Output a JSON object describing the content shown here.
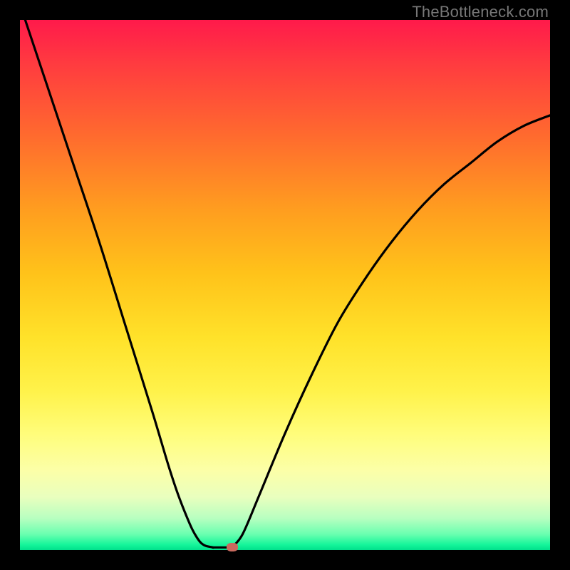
{
  "watermark": "TheBottleneck.com",
  "chart_data": {
    "type": "line",
    "title": "",
    "xlabel": "",
    "ylabel": "",
    "xlim": [
      0,
      100
    ],
    "ylim": [
      0,
      100
    ],
    "note": "Axes have no visible tick labels; values are percentages of plot width/height estimated from pixel positions. y=0 is the bottom (green) edge.",
    "series": [
      {
        "name": "left-branch",
        "x": [
          1,
          5,
          10,
          15,
          20,
          25,
          28,
          30,
          32,
          33,
          34,
          35,
          36.5
        ],
        "y": [
          100,
          88,
          73,
          58,
          42,
          26,
          16,
          10,
          5,
          3,
          1.5,
          0.8,
          0.5
        ]
      },
      {
        "name": "flat-segment",
        "x": [
          36.5,
          40
        ],
        "y": [
          0.5,
          0.5
        ]
      },
      {
        "name": "right-branch",
        "x": [
          40,
          42,
          45,
          50,
          55,
          60,
          65,
          70,
          75,
          80,
          85,
          90,
          95,
          100
        ],
        "y": [
          0.5,
          3,
          10,
          22,
          33,
          43,
          51,
          58,
          64,
          69,
          73,
          77,
          80,
          82
        ]
      }
    ],
    "marker": {
      "x": 40,
      "y": 0.5,
      "name": "min-point"
    },
    "gradient_stops": [
      {
        "pos": 0,
        "color": "#ff1a4b"
      },
      {
        "pos": 60,
        "color": "#ffe22a"
      },
      {
        "pos": 97,
        "color": "#6affb0"
      },
      {
        "pos": 100,
        "color": "#00e08c"
      }
    ]
  }
}
